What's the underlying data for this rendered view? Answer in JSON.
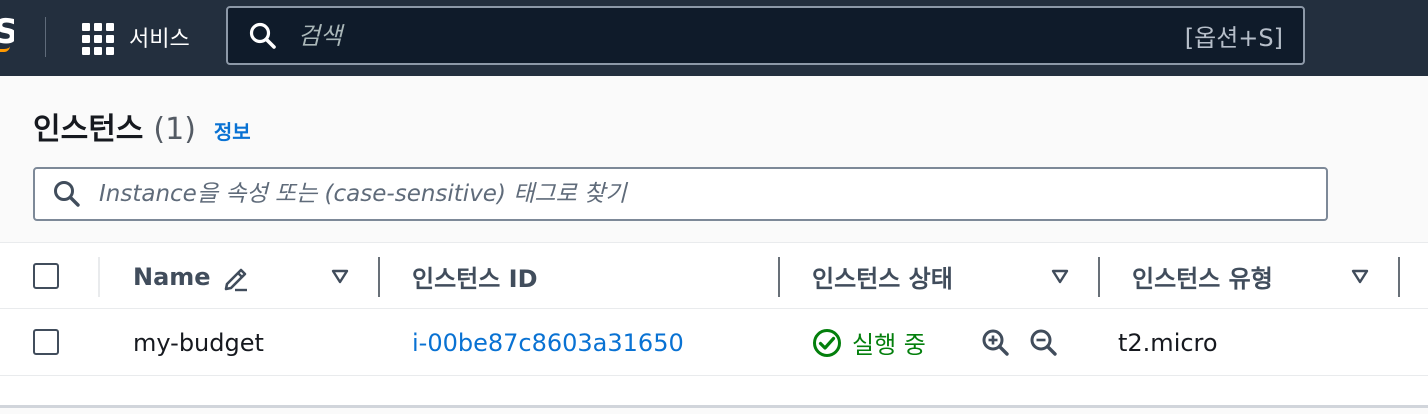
{
  "nav": {
    "services_label": "서비스",
    "search_placeholder": "검색",
    "search_shortcut": "[옵션+S]",
    "logo_fragment": "S"
  },
  "page": {
    "title": "인스턴스",
    "count": "(1)",
    "info_link": "정보"
  },
  "filter": {
    "placeholder": "Instance을 속성 또는 (case-sensitive) 태그로 찾기"
  },
  "table": {
    "columns": {
      "name": "Name",
      "instance_id": "인스턴스 ID",
      "state": "인스턴스 상태",
      "type": "인스턴스 유형"
    },
    "rows": [
      {
        "name": "my-budget",
        "instance_id": "i-00be87c8603a31650",
        "state": "실행 중",
        "type": "t2.micro"
      }
    ]
  },
  "colors": {
    "nav_bg": "#232f3e",
    "link": "#0972d3",
    "running": "#037f0c",
    "brand_orange": "#ff9900"
  }
}
